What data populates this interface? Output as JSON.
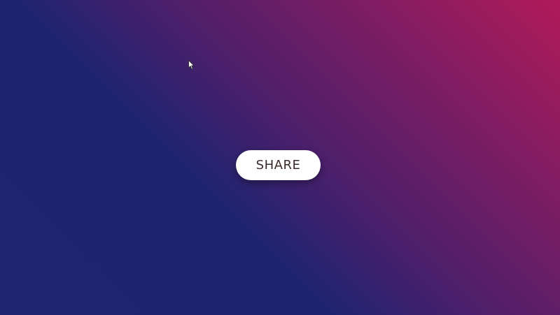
{
  "share_button": {
    "label": "SHARE"
  },
  "cursor": {
    "icon": "mouse-pointer-icon"
  },
  "colors": {
    "background_start": "#b01a5a",
    "background_end": "#1e2573",
    "button_bg": "#ffffff",
    "button_text": "#3a2a2a"
  }
}
